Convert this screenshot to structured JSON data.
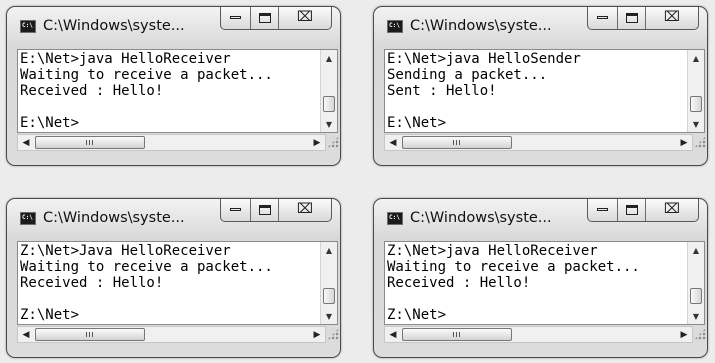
{
  "windows": [
    {
      "title": "C:\\Windows\\syste...",
      "lines": [
        "E:\\Net>java HelloReceiver",
        "Waiting to receive a packet...",
        "Received : Hello!",
        "",
        "E:\\Net>"
      ]
    },
    {
      "title": "C:\\Windows\\syste...",
      "lines": [
        "E:\\Net>java HelloSender",
        "Sending a packet...",
        "Sent : Hello!",
        "",
        "E:\\Net>"
      ]
    },
    {
      "title": "C:\\Windows\\syste...",
      "lines": [
        "Z:\\Net>Java HelloReceiver",
        "Waiting to receive a packet...",
        "Received : Hello!",
        "",
        "Z:\\Net>"
      ]
    },
    {
      "title": "C:\\Windows\\syste...",
      "lines": [
        "Z:\\Net>java HelloReceiver",
        "Waiting to receive a packet...",
        "Received : Hello!",
        "",
        "Z:\\Net>"
      ]
    }
  ],
  "icons": {
    "app": "console-icon",
    "minimize": "minimize-icon",
    "maximize": "maximize-icon",
    "close": "close-icon",
    "close_glyph": "⌧",
    "scroll_up": "▲",
    "scroll_down": "▼",
    "scroll_left": "◀",
    "scroll_right": "▶"
  }
}
